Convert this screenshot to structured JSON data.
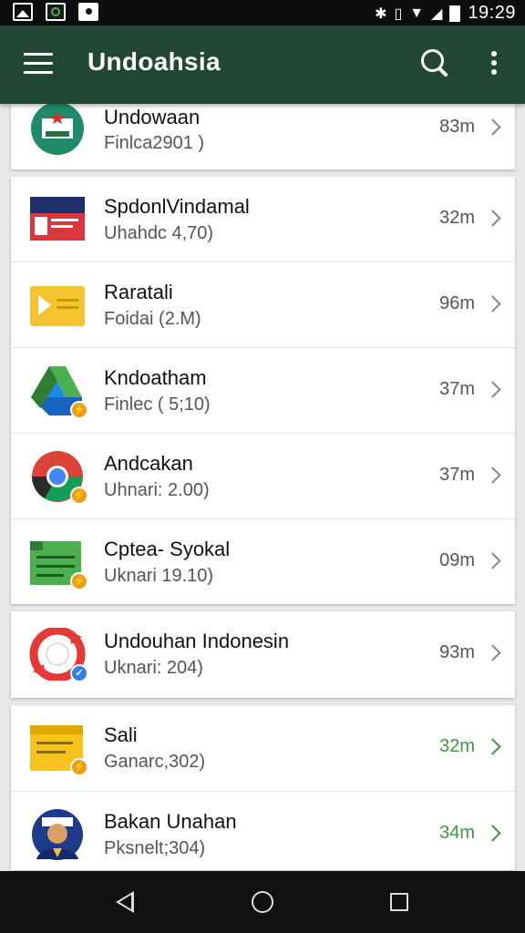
{
  "status_bar": {
    "time": "19:29"
  },
  "app_bar": {
    "title": "Undoahsia"
  },
  "apps": [
    {
      "name": "Undowaan",
      "subtitle": "Finlca2901 )",
      "size": "83m",
      "icon": "flag-emblem-icon"
    },
    {
      "name": "SpdonlVindamal",
      "subtitle": "Uhahdc 4,70)",
      "size": "32m",
      "icon": "document-icon"
    },
    {
      "name": "Raratali",
      "subtitle": "Foidai (2.M)",
      "size": "96m",
      "icon": "folder-play-icon"
    },
    {
      "name": "Kndoatham",
      "subtitle": "Finlec ( 5;10)",
      "size": "37m",
      "icon": "drive-icon"
    },
    {
      "name": "Andcakan",
      "subtitle": "Uhnari: 2.00)",
      "size": "37m",
      "icon": "chrome-icon"
    },
    {
      "name": "Cptea- Syokal",
      "subtitle": "Uknari 19.10)",
      "size": "09m",
      "icon": "sheets-icon"
    },
    {
      "name": "Undouhan Indonesin",
      "subtitle": "Uknari: 204)",
      "size": "93m",
      "icon": "sync-icon"
    },
    {
      "name": "Sali",
      "subtitle": "Ganarc,302)",
      "size": "32m",
      "icon": "note-icon"
    },
    {
      "name": "Bakan Unahan",
      "subtitle": "Pksnelt;304)",
      "size": "34m",
      "icon": "avatar-icon"
    }
  ],
  "colors": {
    "app_bar": "#234735",
    "accent_green": "#3a9a3e"
  }
}
